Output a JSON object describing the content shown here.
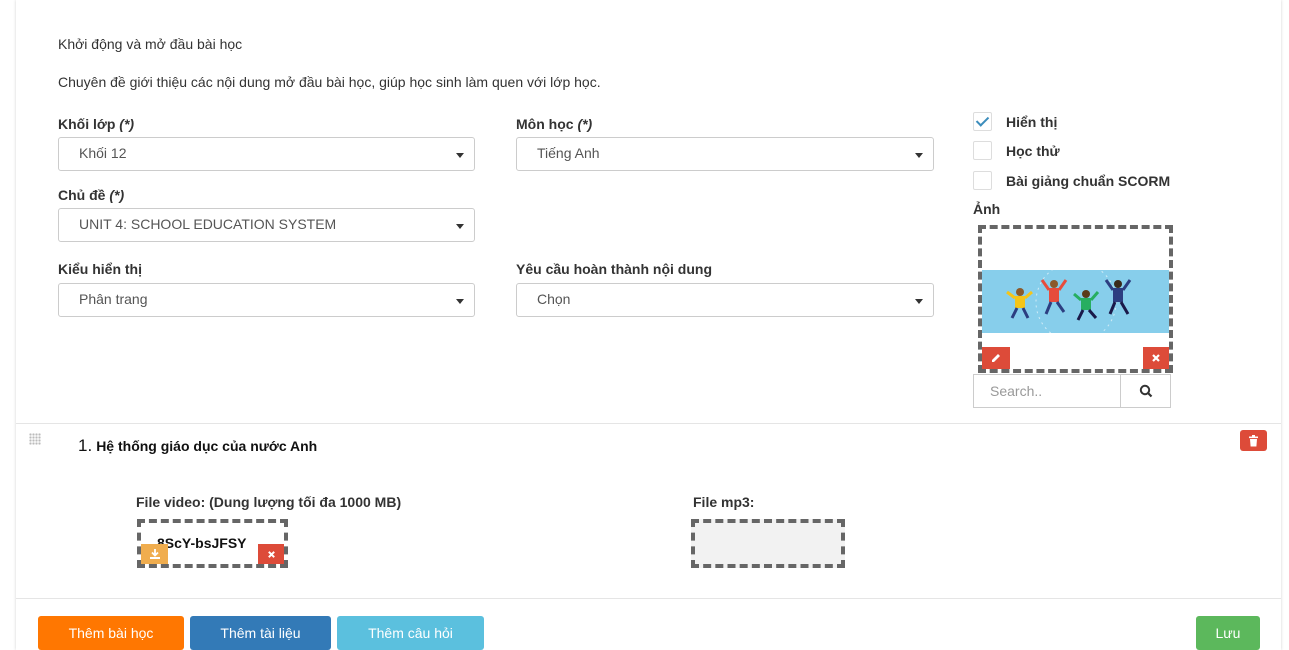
{
  "intro": {
    "title": "Khởi động và mở đầu bài học",
    "description": "Chuyên đề giới thiệu các nội dung mở đầu bài học, giúp học sinh làm quen với lớp học."
  },
  "form": {
    "grade": {
      "label": "Khối lớp",
      "required_mark": "(*)",
      "value": "Khối 12"
    },
    "subject": {
      "label": "Môn học",
      "required_mark": "(*)",
      "value": "Tiếng Anh"
    },
    "topic": {
      "label": "Chủ đề",
      "required_mark": "(*)",
      "value": "UNIT 4: SCHOOL EDUCATION SYSTEM"
    },
    "display_type": {
      "label": "Kiểu hiển thị",
      "value": "Phân trang"
    },
    "completion": {
      "label": "Yêu cầu hoàn thành nội dung",
      "value": "Chọn"
    }
  },
  "options": [
    {
      "label": "Hiển thị",
      "checked": true
    },
    {
      "label": "Học thử",
      "checked": false
    },
    {
      "label": "Bài giảng chuẩn SCORM",
      "checked": false
    }
  ],
  "image": {
    "label": "Ảnh",
    "icon_edit": "pencil-icon",
    "icon_remove": "times-icon"
  },
  "search": {
    "placeholder": "Search..",
    "icon": "search-icon"
  },
  "lesson": {
    "number": "1.",
    "title": "Hệ thống giáo dục của nước Anh",
    "video_label": "File video: (Dung lượng tối đa 1000 MB)",
    "video_file": "8ScY-bsJFSY",
    "mp3_label": "File mp3:"
  },
  "footer": {
    "add_lesson": "Thêm bài học",
    "add_document": "Thêm tài liệu",
    "add_question": "Thêm câu hỏi",
    "save": "Lưu"
  },
  "colors": {
    "orange": "#ff7701",
    "blue": "#337ab7",
    "cyan": "#5bc0de",
    "green": "#5cb85c",
    "red": "#dd4b39",
    "yellow": "#f0ad4e"
  }
}
